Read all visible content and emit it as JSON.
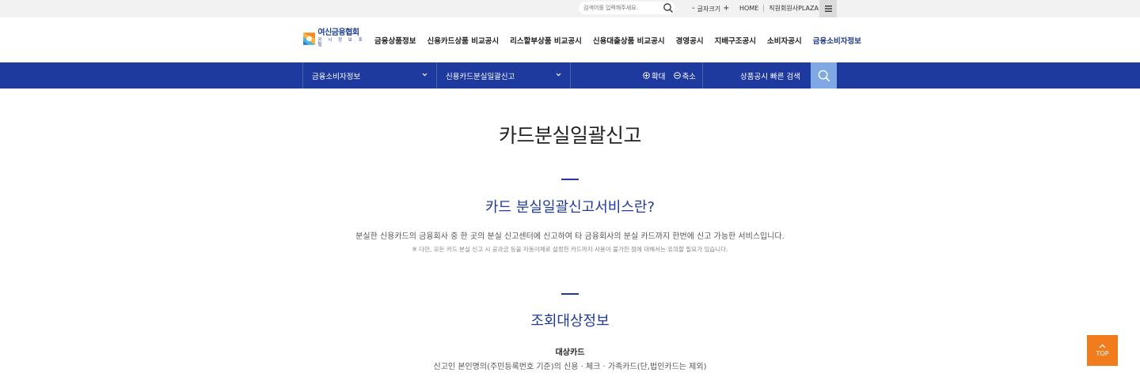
{
  "utility": {
    "search_placeholder": "검색어를 입력해주세요.",
    "font_size_label": "글자크기",
    "font_minus": "-",
    "font_plus": "+",
    "links": [
      "HOME",
      "직원회원사PLAZA"
    ]
  },
  "logo": {
    "line1": "여신금융협회",
    "line2": "공 시 정 보 포 털"
  },
  "gnb": [
    "금융상품정보",
    "신용카드상품 비교공시",
    "리스할부상품 비교공시",
    "신용대출상품 비교공시",
    "경영공시",
    "지배구조공시",
    "소비자공시",
    "금융소비자정보"
  ],
  "navbar": {
    "dropdown1": "금융소비자정보",
    "dropdown2": "신용카드분실일괄신고",
    "zoom_in": "확대",
    "zoom_out": "축소",
    "quick_search": "상품공시 빠른 검색"
  },
  "content": {
    "page_title": "카드분실일괄신고",
    "section1_title": "카드 분실일괄신고서비스란?",
    "section1_desc": "분실한 신용카드의 금융회사 중 한 곳의 분실 신고센터에 신고하여 타 금융회사의 분실 카드까지 한번에 신고 가능한 서비스입니다.",
    "section1_note": "※ 다만, 모든 카드 분실 신고 시 공과금 등을 자동이체로 설정한 카드까지 사용이 불가한 점에 대해서는 유의할 필요가 있습니다.",
    "section2_title": "조회대상정보",
    "target_heading": "대상카드",
    "target_desc": "신고인 본인명의(주민등록번호 기준)의 신용 · 체크 · 가족카드(단,법인카드는 제외)"
  },
  "top_button": "TOP",
  "colors": {
    "primary": "#1f3a9e",
    "accent": "#f07c1e",
    "quick_btn": "#7fa8e4"
  }
}
